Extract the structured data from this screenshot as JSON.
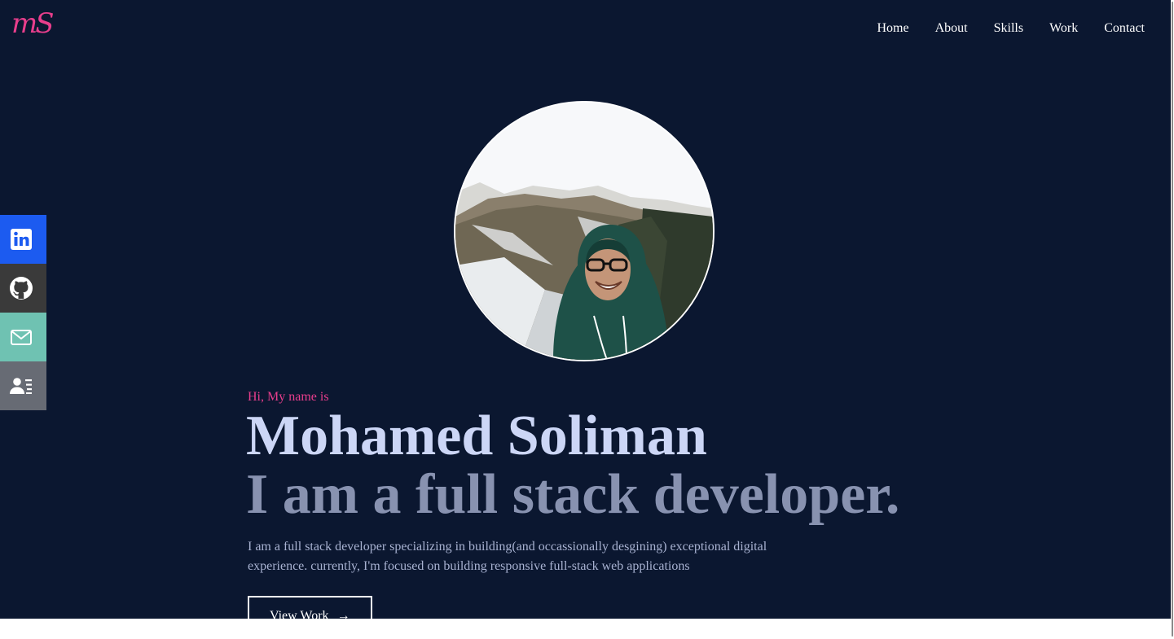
{
  "logo": {
    "text": "mS"
  },
  "nav": {
    "items": [
      "Home",
      "About",
      "Skills",
      "Work",
      "Contact"
    ]
  },
  "social": {
    "items": [
      {
        "name": "linkedin",
        "icon": "linkedin-icon",
        "color": "#1c5bf0"
      },
      {
        "name": "github",
        "icon": "github-icon",
        "color": "#3a3a3a"
      },
      {
        "name": "email",
        "icon": "mail-icon",
        "color": "#6fc2b2"
      },
      {
        "name": "resume",
        "icon": "contact-card-icon",
        "color": "#676b74"
      }
    ]
  },
  "hero": {
    "greeting": "Hi, My name is",
    "name": "Mohamed Soliman",
    "tagline": "I am a full stack developer.",
    "intro": "I am a full stack developer specializing in building(and occassionally desgining) exceptional digital experience. currently, I'm focused on building responsive full-stack web applications",
    "cta_label": "View Work",
    "cta_icon": "arrow-right-icon"
  },
  "colors": {
    "background": "#0b1730",
    "accent": "#e83e8c",
    "heading": "#ccd6f6",
    "subheading": "#8892b0",
    "body_text": "#a8b2d1"
  }
}
